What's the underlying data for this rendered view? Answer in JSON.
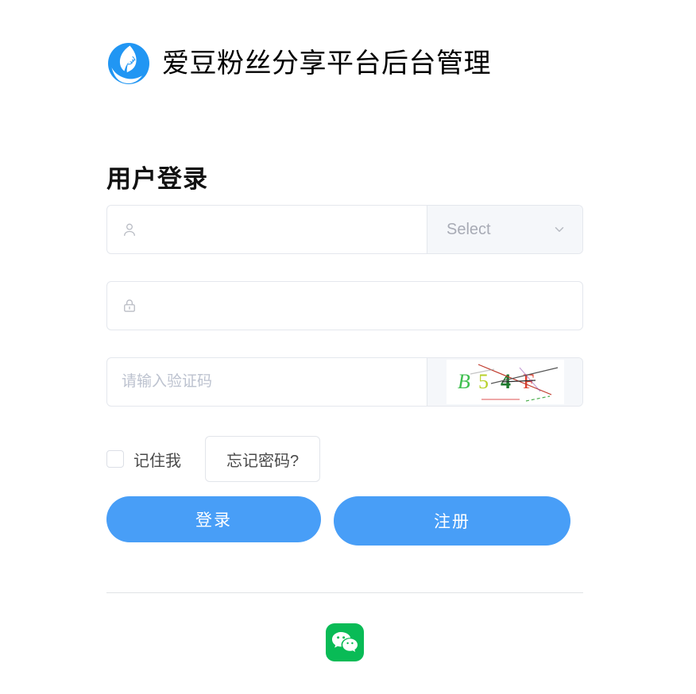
{
  "header": {
    "logo_icon": "idol-face-logo-icon",
    "logo_color": "#2196f3",
    "title": "爱豆粉丝分享平台后台管理"
  },
  "page_title": "用户登录",
  "form": {
    "username": {
      "icon": "user-icon",
      "value": "",
      "placeholder": ""
    },
    "role_select": {
      "label": "Select",
      "icon": "chevron-down-icon"
    },
    "password": {
      "icon": "lock-icon",
      "value": "",
      "placeholder": ""
    },
    "captcha": {
      "value": "",
      "placeholder": "请输入验证码",
      "image_text": "B54F",
      "image_chars": [
        {
          "char": "B",
          "color": "#3fbf4f"
        },
        {
          "char": "5",
          "color": "#b8d12a"
        },
        {
          "char": "4",
          "color": "#1f7a2e"
        },
        {
          "char": "F",
          "color": "#e0412f"
        }
      ]
    }
  },
  "options": {
    "remember_label": "记住我",
    "remember_checked": false,
    "forgot_label": "忘记密码?"
  },
  "actions": {
    "login_label": "登录",
    "register_label": "注册",
    "button_color": "#489ef7"
  },
  "social": {
    "wechat_icon": "wechat-icon",
    "wechat_color": "#09bb56"
  }
}
